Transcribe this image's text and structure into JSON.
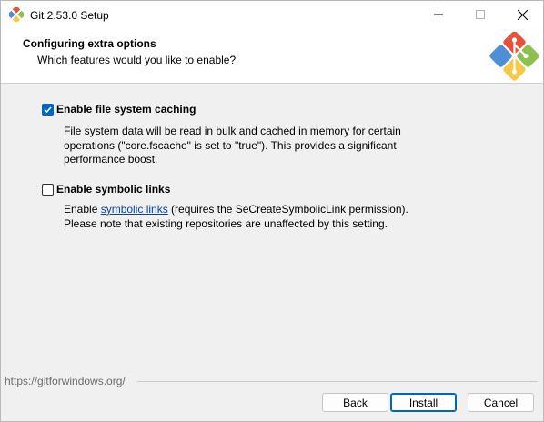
{
  "window": {
    "title": "Git 2.53.0 Setup",
    "icons": {
      "app": "git-app-icon",
      "minimize": "minimize-icon",
      "maximize": "maximize-icon",
      "close": "close-icon"
    }
  },
  "header": {
    "title": "Configuring extra options",
    "subtitle": "Which features would you like to enable?",
    "logo": "git-logo-icon"
  },
  "options": [
    {
      "label": "Enable file system caching",
      "checked": true,
      "description_lines": [
        "File system data will be read in bulk and cached in memory for certain",
        "operations (\"core.fscache\" is set to \"true\"). This provides a significant",
        "performance boost."
      ]
    },
    {
      "label": "Enable symbolic links",
      "checked": false,
      "description_prefix": "Enable ",
      "description_link": "symbolic links",
      "description_suffix": " (requires the SeCreateSymbolicLink permission).",
      "description_line2": "Please note that existing repositories are unaffected by this setting."
    }
  ],
  "footer": {
    "url": "https://gitforwindows.org/",
    "back_label": "Back",
    "install_label": "Install",
    "cancel_label": "Cancel"
  },
  "colors": {
    "accent": "#0067c0",
    "link": "#0645ad",
    "git_red": "#e94f3b",
    "git_blue": "#4f8fd8",
    "git_green": "#8cc152",
    "git_yellow": "#f6c949"
  }
}
